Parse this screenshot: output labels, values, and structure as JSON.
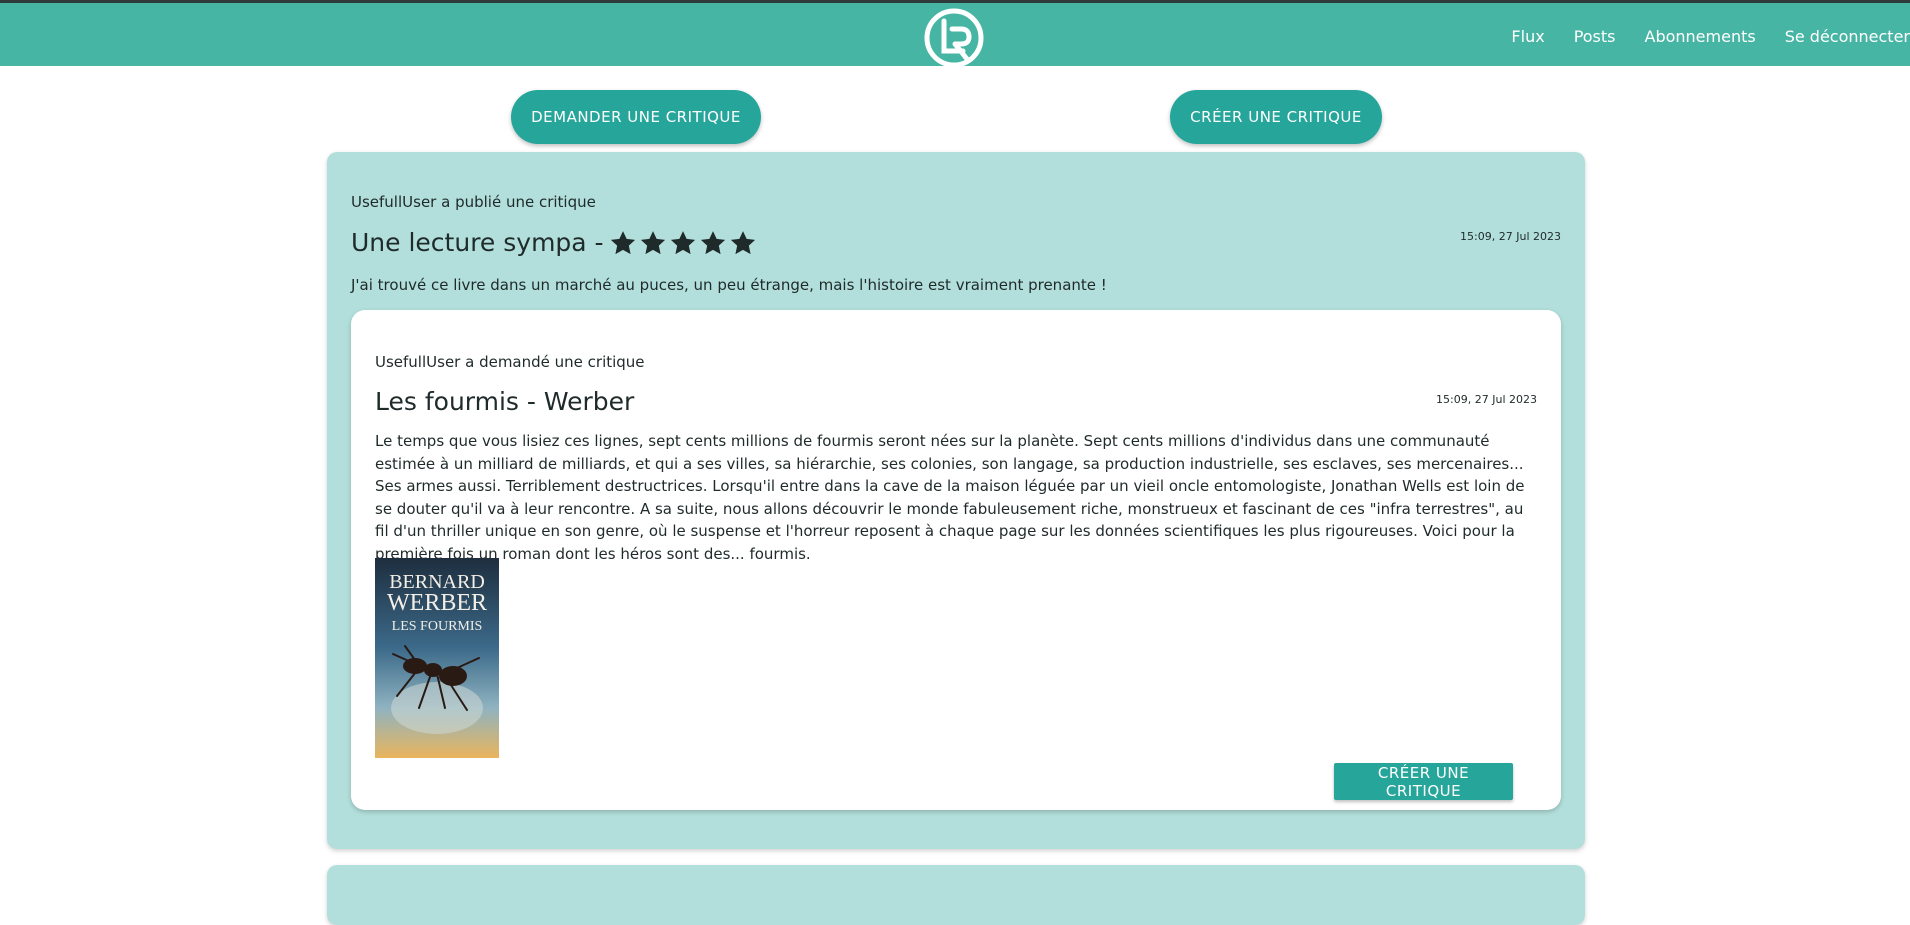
{
  "header": {
    "logo_icon": "lr-logo-icon",
    "brand_color": "#47b5a4",
    "nav": [
      {
        "label": "Flux"
      },
      {
        "label": "Posts"
      },
      {
        "label": "Abonnements"
      },
      {
        "label": "Se déconnecter"
      }
    ]
  },
  "actions": {
    "request_label": "DEMANDER UNE CRITIQUE",
    "create_label": "CRÉER UNE CRITIQUE"
  },
  "feed": {
    "review": {
      "meta": "UsefullUser a publié une critique",
      "headline": "Une lecture sympa -",
      "rating": 5,
      "rating_max": 5,
      "date": "15:09, 27 Jul 2023",
      "body": "J'ai trouvé ce livre dans un marché au puces, un peu étrange, mais l'histoire est vraiment prenante !",
      "ticket": {
        "meta": "UsefullUser a demandé une critique",
        "title": "Les fourmis - Werber",
        "date": "15:09, 27 Jul 2023",
        "description": "Le temps que vous lisiez ces lignes, sept cents millions de fourmis seront nées sur la planète. Sept cents millions d'individus dans une communauté estimée à un milliard de milliards, et qui a ses villes, sa hiérarchie, ses colonies, son langage, sa production industrielle, ses esclaves, ses mercenaires... Ses armes aussi. Terriblement destructrices. Lorsqu'il entre dans la cave de la maison léguée par un vieil oncle entomologiste, Jonathan Wells est loin de se douter qu'il va à leur rencontre. A sa suite, nous allons découvrir le monde fabuleusement riche, monstrueux et fascinant de ces \"infra terrestres\", au fil d'un thriller unique en son genre, où le suspense et l'horreur reposent à chaque page sur les données scientifiques les plus rigoureuses. Voici pour la première fois un roman dont les héros sont des... fourmis.",
        "cover": {
          "author": "BERNARD",
          "author_last": "WERBER",
          "book_title": "LES FOURMIS"
        },
        "button_label": "CRÉER UNE CRITIQUE"
      }
    }
  }
}
